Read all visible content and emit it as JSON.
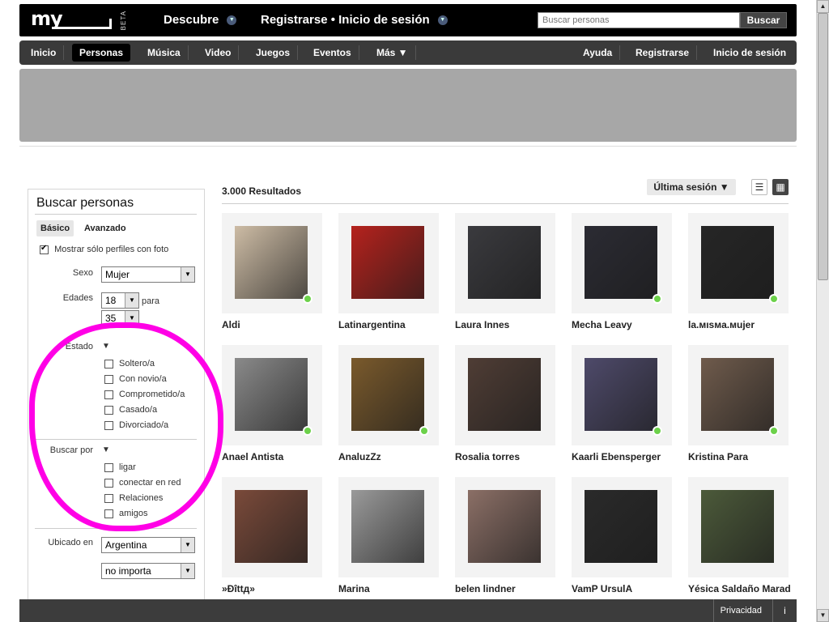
{
  "header": {
    "logo_text": "my",
    "beta": "BETA",
    "discover": "Descubre",
    "register_login": "Registrarse • Inicio de sesión",
    "search_placeholder": "Buscar personas",
    "search_button": "Buscar"
  },
  "nav": {
    "items": [
      "Inicio",
      "Personas",
      "Música",
      "Video",
      "Juegos",
      "Eventos",
      "Más ▼"
    ],
    "right": [
      "Ayuda",
      "Registrarse",
      "Inicio de sesión"
    ]
  },
  "sidebar": {
    "title": "Buscar personas",
    "tabs": [
      "Básico",
      "Avanzado"
    ],
    "photos_only": "Mostrar sólo perfiles con foto",
    "sex_label": "Sexo",
    "sex_value": "Mujer",
    "ages_label": "Edades",
    "age_min": "18",
    "age_to": "para",
    "age_max": "35",
    "status_label": "Estado",
    "status_options": [
      "Soltero/a",
      "Con novio/a",
      "Comprometido/a",
      "Casado/a",
      "Divorciado/a"
    ],
    "search_for_label": "Buscar por",
    "search_for_options": [
      "ligar",
      "conectar en red",
      "Relaciones",
      "amigos"
    ],
    "location_label": "Ubicado en",
    "location_value": "Argentina",
    "location_extra": "no importa"
  },
  "results": {
    "count": "3.000 Resultados",
    "sort": "Última sesión ▼",
    "profiles": [
      {
        "name": "Aldi",
        "online": true,
        "tone": "#cdbca5"
      },
      {
        "name": "Latinargentina",
        "online": false,
        "tone": "#b5221d"
      },
      {
        "name": "Laura Innes",
        "online": false,
        "tone": "#3a3a3e"
      },
      {
        "name": "Mecha Leavy",
        "online": true,
        "tone": "#2b2b33"
      },
      {
        "name": "la.мısмa.мujer",
        "online": true,
        "tone": "#262626"
      },
      {
        "name": "Anael Antista",
        "online": true,
        "tone": "#8a8a8a"
      },
      {
        "name": "AnaluzZz",
        "online": true,
        "tone": "#7a5a2c"
      },
      {
        "name": "Rosalia torres",
        "online": false,
        "tone": "#4f3d35"
      },
      {
        "name": "Kaarli Ebensperger",
        "online": true,
        "tone": "#4e4a6a"
      },
      {
        "name": "Kristina Para",
        "online": true,
        "tone": "#6f5b4c"
      },
      {
        "name": "»Ðîttд»",
        "online": false,
        "tone": "#7a4a3a"
      },
      {
        "name": "Marina",
        "online": false,
        "tone": "#9a9a9a"
      },
      {
        "name": "belen lindner",
        "online": false,
        "tone": "#8b6f66"
      },
      {
        "name": "VamP UrsulA",
        "online": false,
        "tone": "#2a2a2a"
      },
      {
        "name": "Yésica Saldaño Marad",
        "online": false,
        "tone": "#4c5a3a"
      }
    ]
  },
  "footer": {
    "privacy": "Privacidad",
    "info": "i"
  },
  "icons": [
    "dropdown-icon",
    "list-view-icon",
    "grid-view-icon",
    "checkbox-icon",
    "online-indicator-icon",
    "scroll-up-icon",
    "scroll-down-icon"
  ]
}
